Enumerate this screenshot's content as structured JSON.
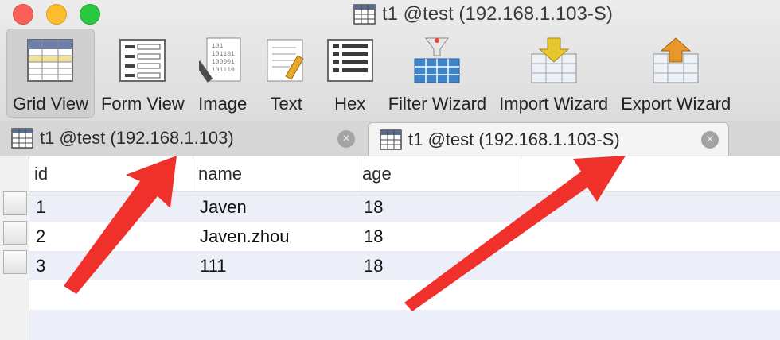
{
  "window": {
    "title": "t1 @test (192.168.1.103-S)"
  },
  "toolbar": {
    "items": [
      {
        "label": "Grid View"
      },
      {
        "label": "Form View"
      },
      {
        "label": "Image"
      },
      {
        "label": "Text"
      },
      {
        "label": "Hex"
      },
      {
        "label": "Filter Wizard"
      },
      {
        "label": "Import Wizard"
      },
      {
        "label": "Export Wizard"
      }
    ]
  },
  "tabs": [
    {
      "label": "t1 @test (192.168.1.103)",
      "close": "×"
    },
    {
      "label": "t1 @test (192.168.1.103-S)",
      "close": "×"
    }
  ],
  "grid": {
    "columns": [
      "id",
      "name",
      "age"
    ],
    "rows": [
      [
        "1",
        "Javen",
        "18"
      ],
      [
        "2",
        "Javen.zhou",
        "18"
      ],
      [
        "3",
        "111",
        "18"
      ]
    ]
  },
  "colors": {
    "arrow": "#f0302a",
    "stripe": "#eceff8",
    "active_tool": "#cfcfcf"
  }
}
